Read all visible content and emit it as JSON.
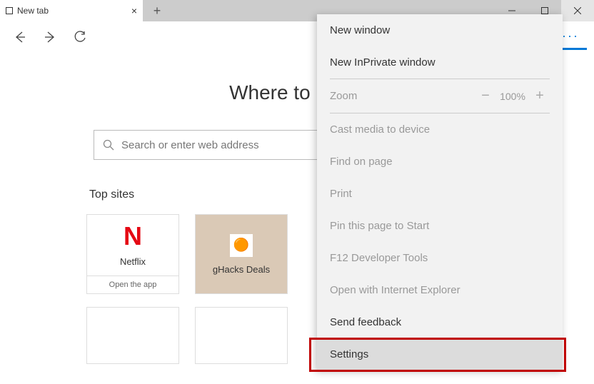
{
  "tab": {
    "title": "New tab"
  },
  "ntp": {
    "heading": "Where to next?",
    "search_placeholder": "Search or enter web address",
    "topsites_label": "Top sites",
    "tiles": [
      {
        "label": "Netflix",
        "sublabel": "Open the app"
      },
      {
        "label": "gHacks Deals"
      }
    ]
  },
  "menu": {
    "new_window": "New window",
    "new_inprivate": "New InPrivate window",
    "zoom_label": "Zoom",
    "zoom_value": "100%",
    "cast": "Cast media to device",
    "find": "Find on page",
    "print": "Print",
    "pin": "Pin this page to Start",
    "devtools": "F12 Developer Tools",
    "open_ie": "Open with Internet Explorer",
    "feedback": "Send feedback",
    "settings": "Settings"
  }
}
